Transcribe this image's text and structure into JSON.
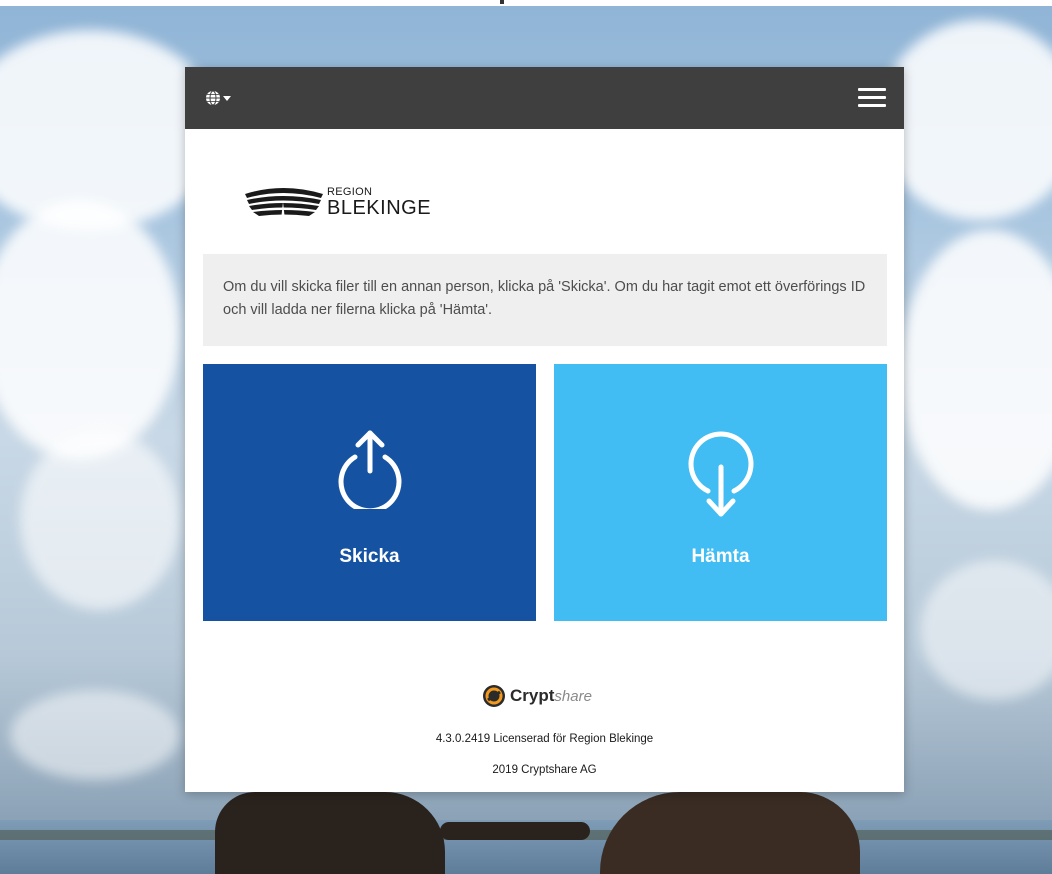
{
  "header": {
    "language_icon": "globe-icon",
    "language_caret_icon": "caret-down-icon",
    "menu_icon": "hamburger-menu-icon"
  },
  "logo": {
    "line1": "REGION",
    "line2": "BLEKINGE"
  },
  "intro_text": "Om du vill skicka filer till en annan person, klicka på 'Skicka'. Om du har tagit emot ett överförings ID och vill ladda ner filerna klicka på 'Hämta'.",
  "actions": {
    "send": {
      "label": "Skicka",
      "icon": "upload-icon",
      "color": "#1553a2"
    },
    "fetch": {
      "label": "Hämta",
      "icon": "download-icon",
      "color": "#41bdf4"
    }
  },
  "footer": {
    "brand_bold": "Crypt",
    "brand_light": "share",
    "license": "4.3.0.2419 Licenserad för Region Blekinge",
    "copyright": "2019 Cryptshare AG"
  },
  "colors": {
    "navbar": "#3f3f3f",
    "info_bg": "#efefef"
  }
}
